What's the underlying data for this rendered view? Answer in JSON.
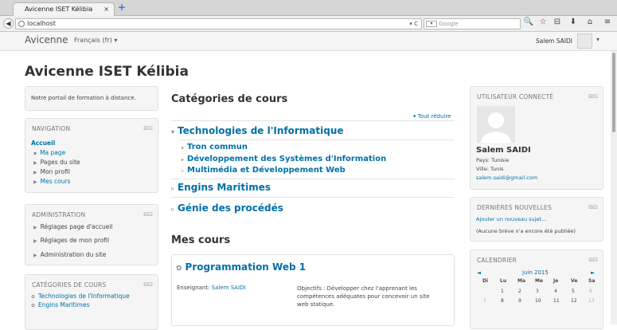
{
  "browser": {
    "tab_title": "Avicenne ISET Kélibia",
    "tab_close": "×",
    "new_tab": "+",
    "back": "◀",
    "url": "localhost",
    "url_controls": "▾ C",
    "search_placeholder": "Google",
    "search_engine": "▾",
    "toolbar_icons": [
      "🔍",
      "☆",
      "⊟",
      "⬇",
      "⌂",
      "≡"
    ]
  },
  "header": {
    "brand": "Avicenne",
    "language": "Français (fr) ▾",
    "user_name": "Salem SAIDI",
    "user_caret": "▾"
  },
  "page_title": "Avicenne ISET Kélibia",
  "left": {
    "portal_text": "Notre portail de formation à distance.",
    "navigation": {
      "title": "NAVIGATION",
      "controls": "⊟⊡",
      "items": [
        {
          "label": "Accueil"
        },
        {
          "label": "Ma page",
          "marker": "▪"
        },
        {
          "label": "Pages du site",
          "marker": "▶"
        },
        {
          "label": "Mon profil",
          "marker": "▶"
        },
        {
          "label": "Mes cours",
          "marker": "▶"
        }
      ]
    },
    "administration": {
      "title": "ADMINISTRATION",
      "controls": "⊟⊡",
      "items": [
        {
          "label": "Réglages page d'accueil",
          "marker": "▶"
        },
        {
          "label": "Réglages de mon profil",
          "marker": "▶"
        },
        {
          "label": "Administration du site",
          "marker": "▶"
        }
      ]
    },
    "categories": {
      "title": "CATÉGORIES DE COURS",
      "controls": "⊟⊡",
      "items": [
        {
          "label": "Technologies de l'Informatique",
          "marker": "✿"
        },
        {
          "label": "Engins Maritimes",
          "marker": "✿"
        }
      ]
    }
  },
  "main": {
    "categories_title": "Catégories de cours",
    "collapse_all": "▾ Tout réduire",
    "categories": [
      {
        "label": "Technologies de l'Informatique",
        "marker": "▾",
        "children": [
          {
            "label": "Tron commun",
            "marker": "▸"
          },
          {
            "label": "Développement des Systèmes d'Information",
            "marker": "▸"
          },
          {
            "label": "Multimédia et Développement Web",
            "marker": "▹"
          }
        ]
      },
      {
        "label": "Engins Maritimes",
        "marker": "▹"
      },
      {
        "label": "Génie des procédés",
        "marker": "▹"
      }
    ],
    "my_courses_title": "Mes cours",
    "course": {
      "icon": "✿",
      "name": "Programmation Web 1",
      "teacher_label": "Enseignant: ",
      "teacher": "Salem SAIDI",
      "summary": "Objectifs : Développer chez l'apprenant les compétences adéquates pour concevoir un site web statique."
    }
  },
  "right": {
    "connected": {
      "title": "UTILISATEUR CONNECTÉ",
      "controls": "⊟⊡",
      "name": "Salem SAIDI",
      "country": "Pays: Tunisie",
      "city": "Ville: Tunis",
      "email": "salem.saidi@gmail.com"
    },
    "news": {
      "title": "DERNIÈRES NOUVELLES",
      "controls": "⊟⊡",
      "add": "Ajouter un nouveau sujet...",
      "empty": "(Aucune brève n'a encore été publiée)"
    },
    "calendar": {
      "title": "CALENDRIER",
      "controls": "⊟⊡",
      "prev": "◄",
      "next": "►",
      "month": "juin 2015",
      "days": [
        "Di",
        "Lu",
        "Ma",
        "Me",
        "Je",
        "Ve",
        "Sa"
      ],
      "week1": [
        "",
        "1",
        "2",
        "3",
        "4",
        "5",
        "6"
      ],
      "week2": [
        "7",
        "8",
        "9",
        "10",
        "11",
        "12",
        "13"
      ]
    }
  },
  "colors": {
    "link": "#0070a8",
    "block_bg": "#f5f5f5"
  }
}
